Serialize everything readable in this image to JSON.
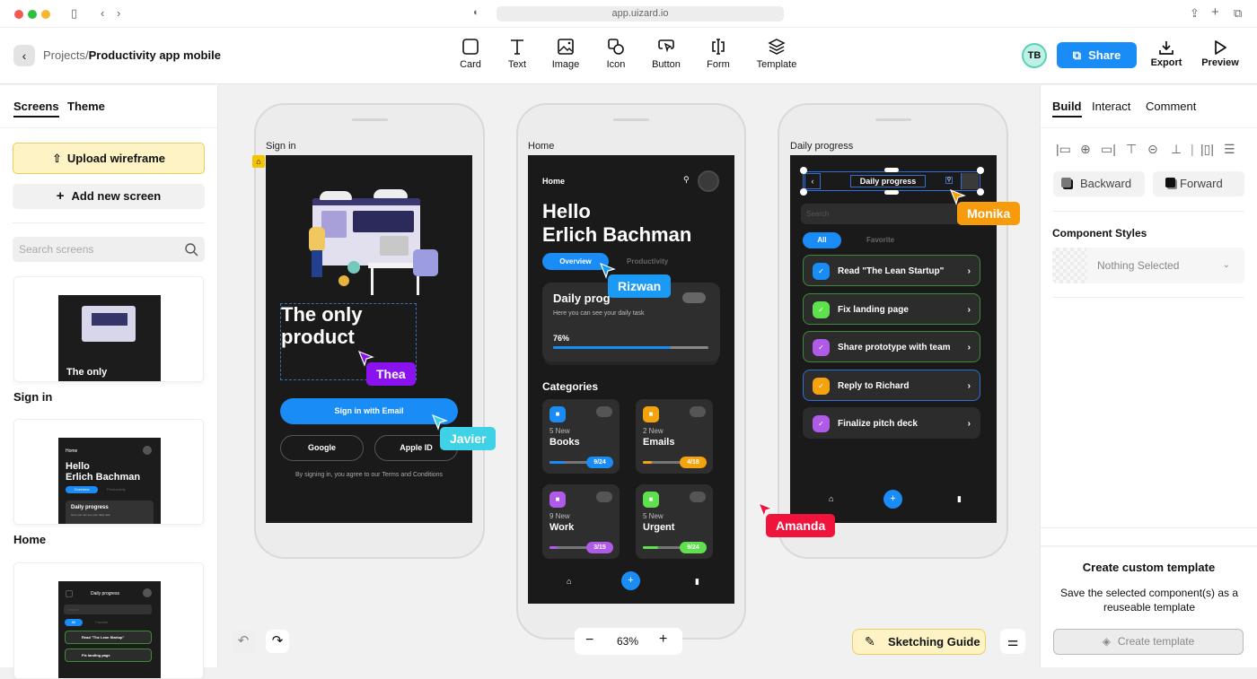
{
  "browser": {
    "url": "app.uizard.io"
  },
  "header": {
    "back_label": "‹",
    "breadcrumb_parent": "Projects",
    "breadcrumb_separator": "/",
    "breadcrumb_current": "Productivity app mobile",
    "tools": [
      {
        "label": "Card",
        "icon": "card-icon"
      },
      {
        "label": "Text",
        "icon": "text-icon"
      },
      {
        "label": "Image",
        "icon": "image-icon"
      },
      {
        "label": "Icon",
        "icon": "shapes-icon"
      },
      {
        "label": "Button",
        "icon": "button-icon"
      },
      {
        "label": "Form",
        "icon": "form-icon"
      },
      {
        "label": "Template",
        "icon": "layers-icon"
      }
    ],
    "avatar_initials": "TB",
    "share_label": "Share",
    "export_label": "Export",
    "preview_label": "Preview"
  },
  "left_panel": {
    "tabs": [
      "Screens",
      "Theme"
    ],
    "active_tab": "Screens",
    "upload_label": "Upload wireframe",
    "add_screen_label": "Add new screen",
    "search_placeholder": "Search screens",
    "screens": [
      {
        "name": "Sign in",
        "preview_text": "The only"
      },
      {
        "name": "Home",
        "preview_header": "Home",
        "preview_title1": "Hello",
        "preview_title2": "Erlich Bachman",
        "preview_tab1": "Overview",
        "preview_tab2": "Productivity",
        "preview_card": "Daily progress",
        "preview_sub": "Here you can see your daily task"
      },
      {
        "name": "Daily progress",
        "preview_header": "Daily progress",
        "preview_search": "Search",
        "preview_all": "All",
        "preview_fav": "Favorite",
        "preview_task1": "Read \"The Lean Startup\"",
        "preview_task2": "Fix landing page"
      }
    ]
  },
  "canvas": {
    "signin": {
      "label": "Sign in",
      "headline_line1": "The only",
      "headline_line2": "product",
      "email_button": "Sign in with Email",
      "google_button": "Google",
      "apple_button": "Apple ID",
      "terms": "By signing in, you agree to our Terms and Conditions"
    },
    "home": {
      "label": "Home",
      "header": "Home",
      "greeting1": "Hello",
      "greeting2": "Erlich Bachman",
      "tab_overview": "Overview",
      "tab_productivity": "Productivity",
      "progress_title": "Daily prog",
      "progress_sub": "Here you can see your daily task",
      "progress_value": "76%",
      "progress_fraction": 0.76,
      "categories_title": "Categories",
      "categories": [
        {
          "new": "5 New",
          "name": "Books",
          "count": "9/24",
          "progress": 0.375,
          "color": "#1a8cf5"
        },
        {
          "new": "2 New",
          "name": "Emails",
          "count": "4/18",
          "progress": 0.22,
          "color": "#f5a30c"
        },
        {
          "new": "9 New",
          "name": "Work",
          "count": "3/15",
          "progress": 0.2,
          "color": "#b05ae8"
        },
        {
          "new": "5 New",
          "name": "Urgent",
          "count": "9/24",
          "progress": 0.375,
          "color": "#5fe04e"
        }
      ]
    },
    "daily": {
      "label": "Daily progress",
      "header": "Daily progress",
      "search_placeholder": "Search",
      "filter_all": "All",
      "filter_favorite": "Favorite",
      "tasks": [
        {
          "label": "Read \"The Lean Startup\"",
          "color": "#1a8cf5",
          "border": "#3f8a3a"
        },
        {
          "label": "Fix landing page",
          "color": "#5fe04e",
          "border": "#3f8a3a"
        },
        {
          "label": "Share prototype with team",
          "color": "#b05ae8",
          "border": "#3f8a3a"
        },
        {
          "label": "Reply to Richard",
          "color": "#f5a30c",
          "border": "#2f6fd6"
        },
        {
          "label": "Finalize pitch deck",
          "color": "#b05ae8",
          "border": "none"
        }
      ]
    },
    "collaborators": [
      {
        "name": "Thea",
        "color": "#8a12ee"
      },
      {
        "name": "Javier",
        "color": "#3fd2e6"
      },
      {
        "name": "Rizwan",
        "color": "#1a9af5"
      },
      {
        "name": "Monika",
        "color": "#f59b0c"
      },
      {
        "name": "Amanda",
        "color": "#f0143c"
      }
    ],
    "zoom_level": "63%",
    "sketching_guide_label": "Sketching Guide"
  },
  "right_panel": {
    "tabs": [
      "Build",
      "Interact",
      "Comment"
    ],
    "active_tab": "Build",
    "backward_label": "Backward",
    "forward_label": "Forward",
    "component_styles_title": "Component Styles",
    "component_styles_value": "Nothing Selected",
    "template_title": "Create custom template",
    "template_desc": "Save the selected component(s) as a reuseable template",
    "create_template_label": "Create template"
  }
}
